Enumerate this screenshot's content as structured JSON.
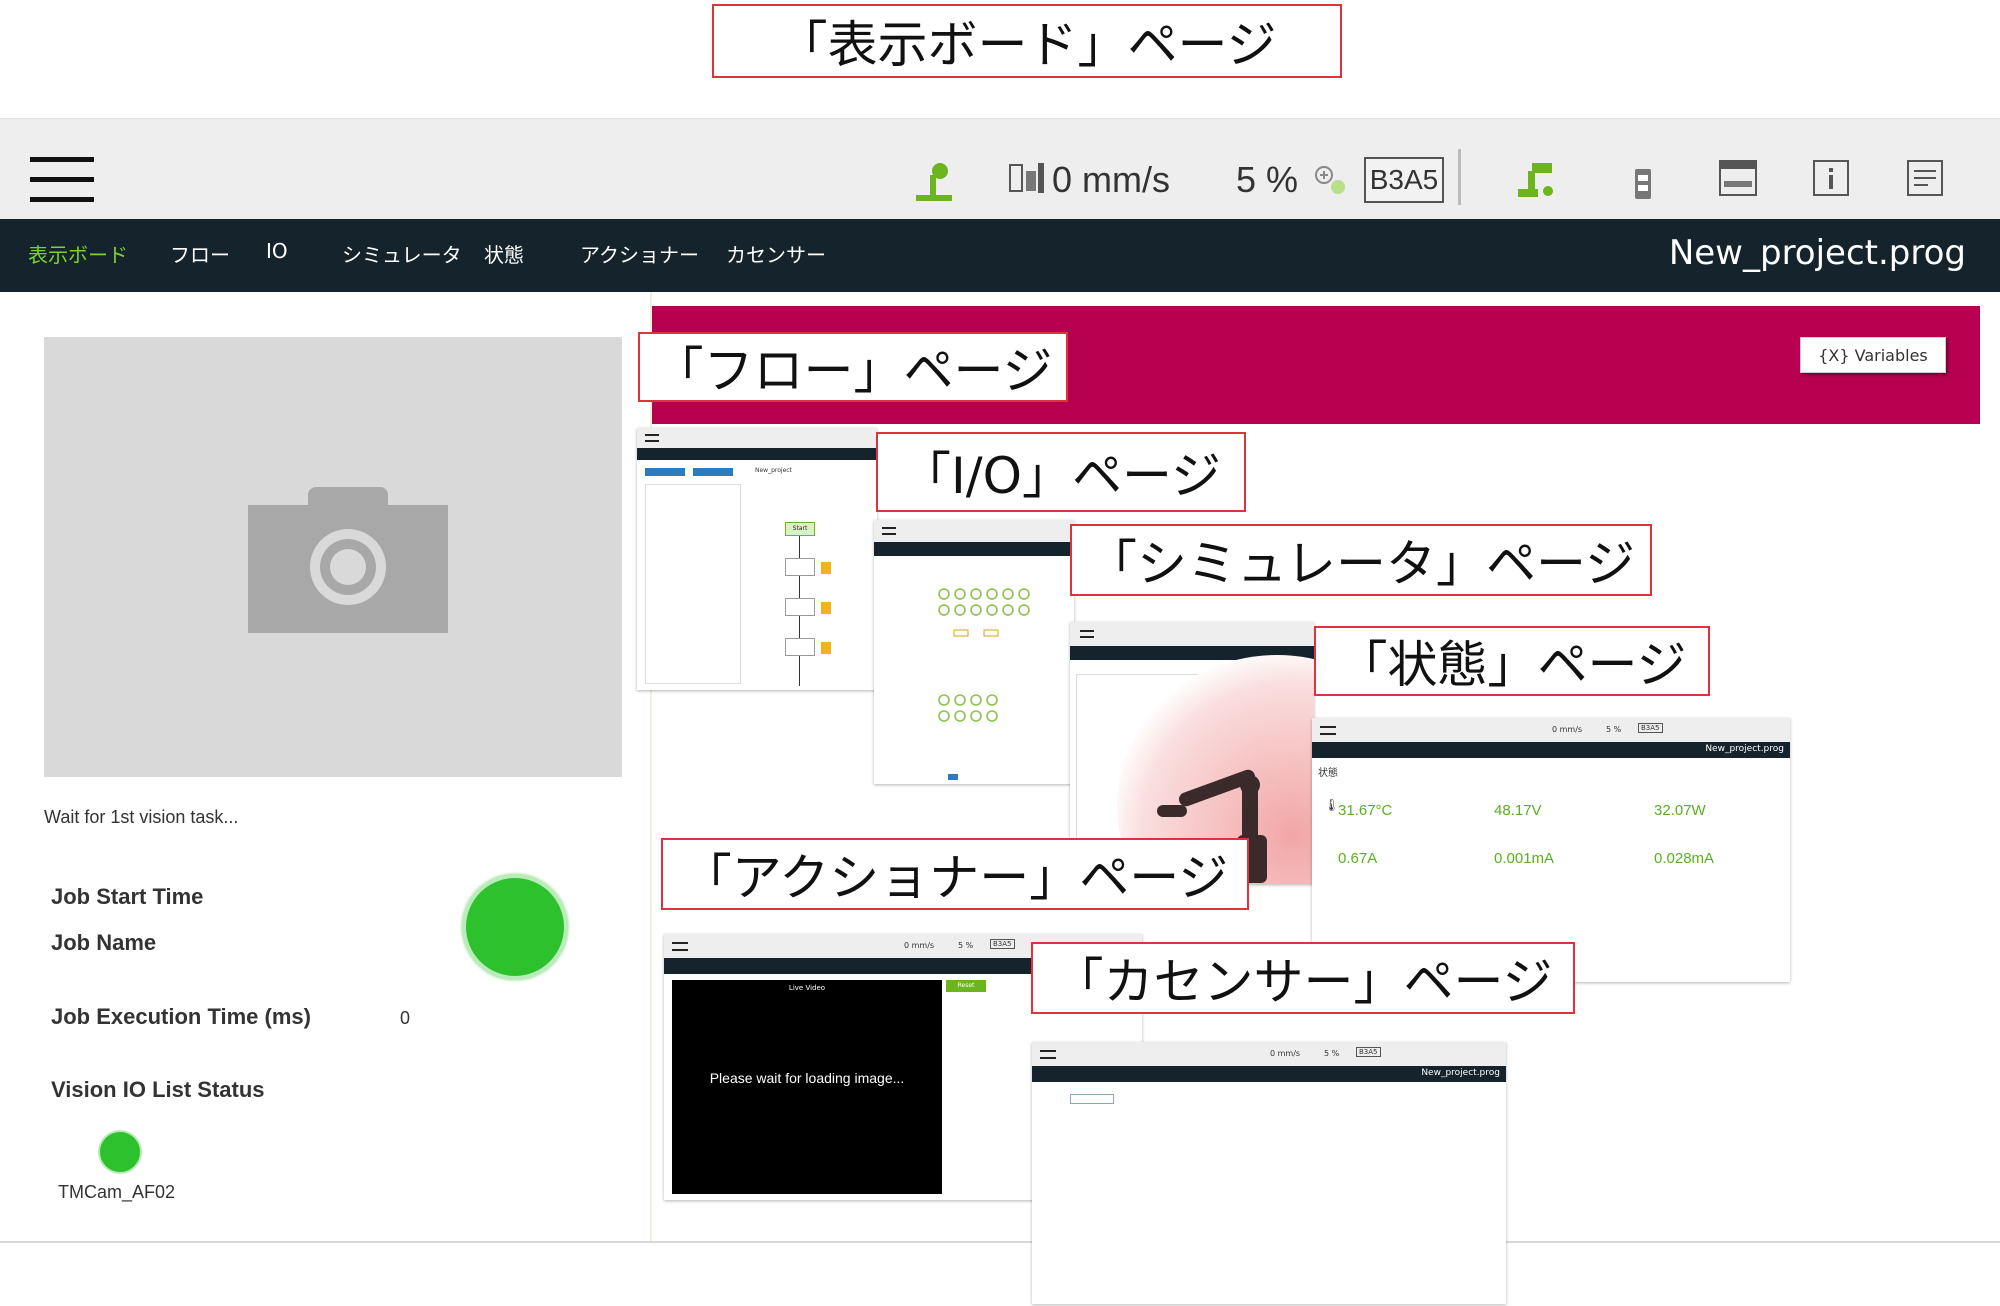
{
  "callouts": {
    "dashboard": "「表示ボード」ページ",
    "flow": "「フロー」ページ",
    "io": "「I/O」ページ",
    "simulator": "「シミュレータ」ページ",
    "status": "「状態」ページ",
    "actioner": "「アクショナー」ページ",
    "force_sensor": "「カセンサー」ページ"
  },
  "topbar": {
    "speed": "0 mm/s",
    "percent": "5 %",
    "code": "B3A5"
  },
  "nav": {
    "items": [
      "表示ボード",
      "フロー",
      "IO",
      "シミュレータ",
      "状態",
      "アクショナー",
      "カセンサー"
    ],
    "active_index": 0,
    "project_name": "New_project.prog"
  },
  "dashboard": {
    "vision_status": "Wait for 1st vision task...",
    "job_start_time": "Job Start Time",
    "job_name": "Job Name",
    "job_exec_time": "Job Execution Time (ms)",
    "job_exec_value": "0",
    "vision_io_status": "Vision IO List Status",
    "camera_name": "TMCam_AF02"
  },
  "flow_page": {
    "variables_button": "{X} Variables",
    "start_node": "Start",
    "project_tab": "New_project"
  },
  "status_page": {
    "title": "状態",
    "speed": "0 mm/s",
    "percent": "5 %",
    "code": "B3A5",
    "project": "New_project.prog",
    "values": [
      "31.67°C",
      "48.17V",
      "32.07W",
      "0.67A",
      "0.001mA",
      "0.028mA"
    ]
  },
  "actioner_page": {
    "live_video": "Live Video",
    "loading": "Please wait for loading image...",
    "button": "Reset",
    "speed": "0 mm/s",
    "percent": "5 %",
    "code": "B3A5"
  },
  "force_page": {
    "speed": "0 mm/s",
    "percent": "5 %",
    "code": "B3A5",
    "project": "New_project.prog"
  },
  "colors": {
    "accent_green": "#7bd12f",
    "nav_bg": "#14232c",
    "header_magenta": "#b80050",
    "callout_border": "#e0323c",
    "status_green": "#2ec12e"
  }
}
